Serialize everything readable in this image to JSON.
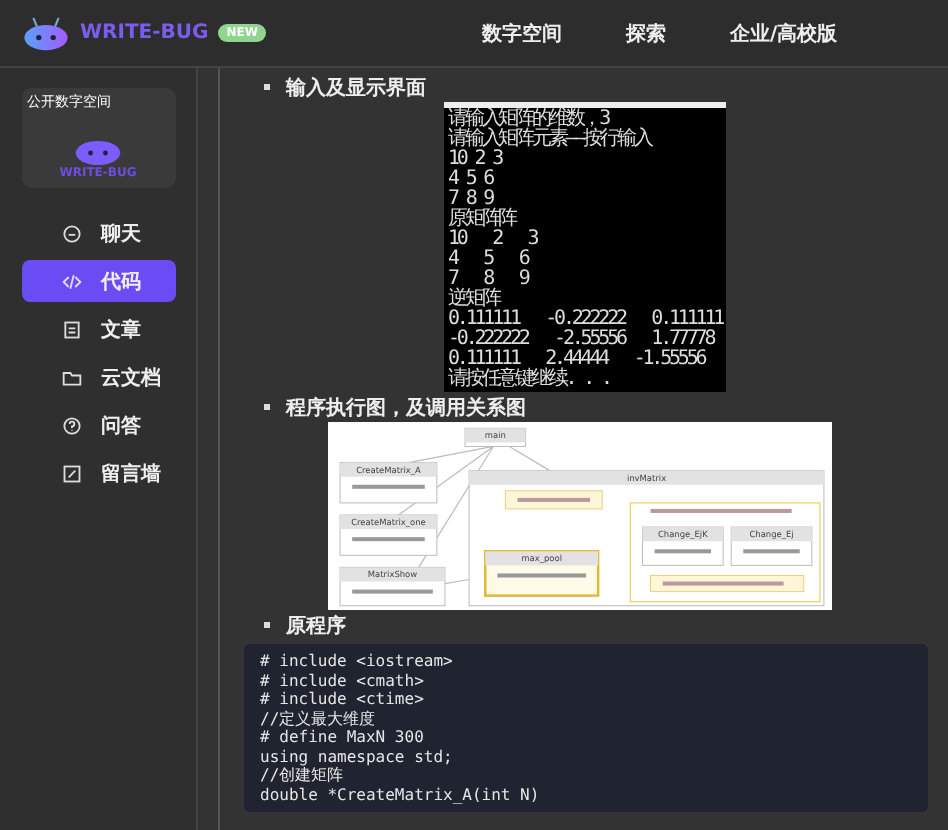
{
  "header": {
    "brand": "WRITE-BUG",
    "badge": "NEW",
    "nav": [
      {
        "label": "数字空间"
      },
      {
        "label": "探索"
      },
      {
        "label": "企业/高校版"
      }
    ]
  },
  "sidebar": {
    "card": {
      "tag": "公开数字空间",
      "brand": "WRITE-BUG"
    },
    "items": [
      {
        "label": "聊天",
        "selected": false
      },
      {
        "label": "代码",
        "selected": true
      },
      {
        "label": "文章",
        "selected": false
      },
      {
        "label": "云文档",
        "selected": false
      },
      {
        "label": "问答",
        "selected": false
      },
      {
        "label": "留言墙",
        "selected": false
      }
    ]
  },
  "sections": [
    {
      "heading": "输入及显示界面",
      "kind": "console",
      "lines": [
        "请输入矩阵的维数，3",
        "请输入矩阵元素——按行输入",
        "10 2 3",
        "4 5 6",
        "7 8 9",
        "原矩阵阵",
        "10   2   3",
        "4   5   6",
        "7   8   9",
        "逆矩阵",
        "0.111111   -0.222222   0.111111",
        "-0.222222   -2.55556   1.77778",
        "0.111111   2.44444   -1.55556",
        "请按任意键继续. . ."
      ]
    },
    {
      "heading": "程序执行图，及调用关系图",
      "kind": "diagram",
      "nodes": [
        {
          "label": "main"
        },
        {
          "label": "CreateMatrix_A"
        },
        {
          "label": "CreateMatrix_one"
        },
        {
          "label": "MatrixShow"
        },
        {
          "label": "invMatrix"
        },
        {
          "label": "max_pool"
        },
        {
          "label": "Change_EjK"
        },
        {
          "label": "Change_Ej"
        }
      ]
    },
    {
      "heading": "原程序",
      "kind": "code",
      "lines": [
        "# include <iostream>",
        "# include <cmath>",
        "# include <ctime>",
        "//定义最大维度",
        "# define MaxN 300",
        "using namespace std;",
        "//创建矩阵",
        "double *CreateMatrix_A(int N)"
      ]
    }
  ]
}
